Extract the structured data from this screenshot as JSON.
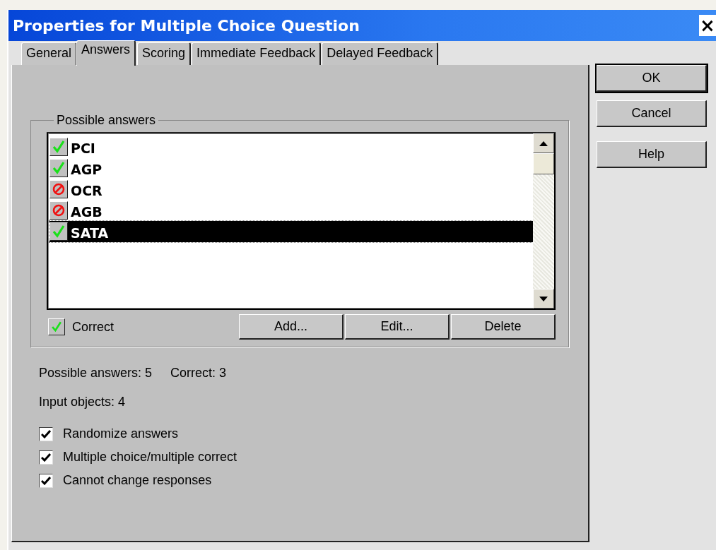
{
  "window": {
    "title": "Properties for Multiple Choice Question",
    "close_label": "×"
  },
  "tabs": [
    {
      "label": "General",
      "selected": false
    },
    {
      "label": "Answers",
      "selected": true
    },
    {
      "label": "Scoring",
      "selected": false
    },
    {
      "label": "Immediate Feedback",
      "selected": false
    },
    {
      "label": "Delayed Feedback",
      "selected": false
    }
  ],
  "possible_answers": {
    "legend": "Possible answers",
    "answers": [
      {
        "text": "PCI",
        "correct": true,
        "selected": false
      },
      {
        "text": "AGP",
        "correct": true,
        "selected": false
      },
      {
        "text": "OCR",
        "correct": false,
        "selected": false
      },
      {
        "text": "AGB",
        "correct": false,
        "selected": false
      },
      {
        "text": "SATA",
        "correct": true,
        "selected": true
      }
    ],
    "correct_toggle": {
      "label": "Correct",
      "checked": true
    },
    "buttons": [
      "Add...",
      "Edit...",
      "Delete"
    ]
  },
  "summary": {
    "possible_answers": "Possible answers: 5",
    "correct": "Correct: 3",
    "input_objects": "Input objects: 4"
  },
  "options": [
    {
      "label": "Randomize answers",
      "checked": true
    },
    {
      "label": "Multiple choice/multiple correct",
      "checked": true
    },
    {
      "label": "Cannot change responses",
      "checked": true
    }
  ],
  "side_buttons": [
    "OK",
    "Cancel",
    "Help"
  ]
}
